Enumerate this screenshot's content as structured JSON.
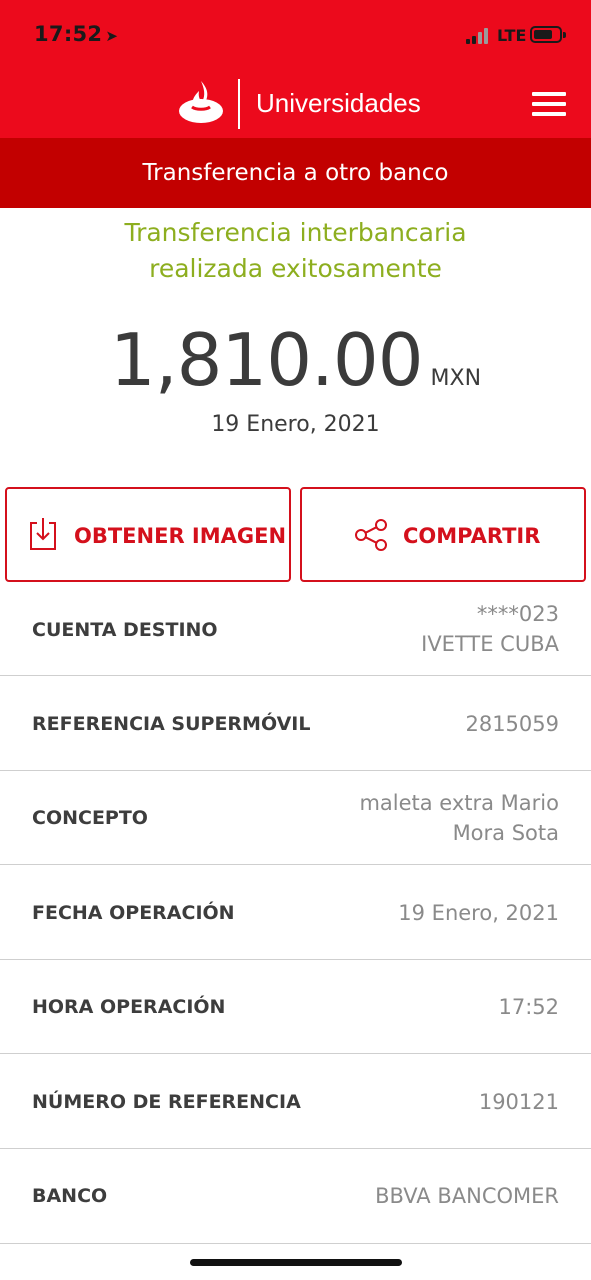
{
  "status_bar": {
    "time": "17:52",
    "network": "LTE",
    "signal_bars_active": 2,
    "signal_bars_total": 4,
    "battery_level": 0.6
  },
  "header": {
    "brand": "Universidades",
    "menu_icon": "hamburger-menu-icon",
    "logo_icon": "santander-flame-icon",
    "brand_color": "#ec0a1c"
  },
  "sub_header": {
    "title": "Transferencia a otro banco",
    "color": "#c20000"
  },
  "confirmation": {
    "message_line1": "Transferencia interbancaria",
    "message_line2": "realizada exitosamente",
    "message_color": "#8dae1f",
    "amount": "1,810.00",
    "currency": "MXN",
    "date": "19 Enero, 2021"
  },
  "actions": {
    "get_image": {
      "label": "OBTENER IMAGEN",
      "icon": "download-icon"
    },
    "share": {
      "label": "COMPARTIR",
      "icon": "share-icon"
    },
    "accent_color": "#d4101c"
  },
  "details": [
    {
      "label": "CUENTA DESTINO",
      "value_lines": [
        "****023",
        "IVETTE CUBA"
      ]
    },
    {
      "label": "REFERENCIA SUPERMÓVIL",
      "value_lines": [
        "2815059"
      ]
    },
    {
      "label": "CONCEPTO",
      "value_lines": [
        "maleta extra Mario",
        "Mora Sota"
      ]
    },
    {
      "label": "FECHA OPERACIÓN",
      "value_lines": [
        "19 Enero, 2021"
      ]
    },
    {
      "label": "HORA OPERACIÓN",
      "value_lines": [
        "17:52"
      ]
    },
    {
      "label": "NÚMERO DE REFERENCIA",
      "value_lines": [
        "190121"
      ]
    },
    {
      "label": "BANCO",
      "value_lines": [
        "BBVA BANCOMER"
      ]
    }
  ]
}
